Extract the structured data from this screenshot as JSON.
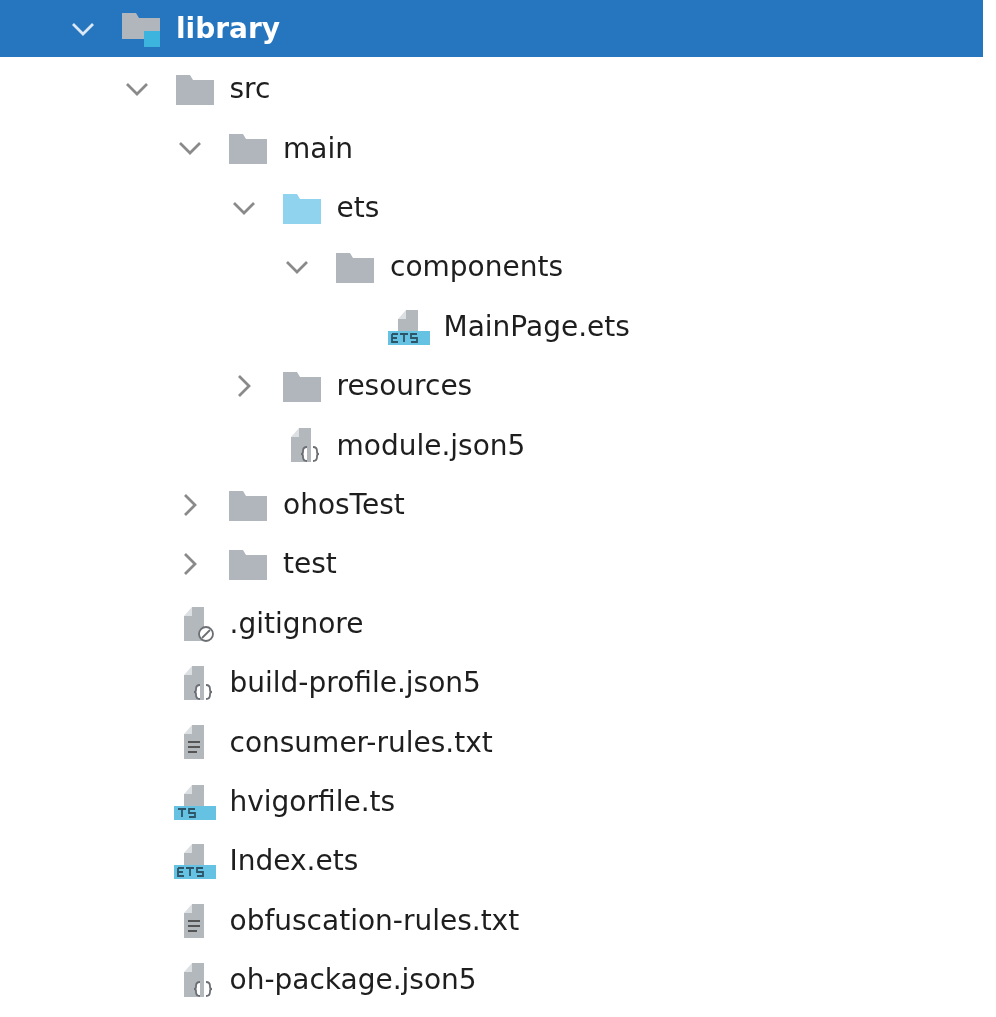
{
  "tree": [
    {
      "name": "library",
      "kind": "module",
      "expanded": true,
      "selected": true,
      "children": [
        {
          "name": "src",
          "kind": "folder",
          "expanded": true,
          "selected": false,
          "children": [
            {
              "name": "main",
              "kind": "folder",
              "expanded": true,
              "selected": false,
              "children": [
                {
                  "name": "ets",
                  "kind": "source-folder",
                  "expanded": true,
                  "selected": false,
                  "children": [
                    {
                      "name": "components",
                      "kind": "folder",
                      "expanded": true,
                      "selected": false,
                      "children": [
                        {
                          "name": "MainPage.ets",
                          "kind": "ets",
                          "selected": false
                        }
                      ]
                    }
                  ]
                },
                {
                  "name": "resources",
                  "kind": "folder",
                  "expanded": false,
                  "selected": false
                },
                {
                  "name": "module.json5",
                  "kind": "json",
                  "selected": false
                }
              ]
            },
            {
              "name": "ohosTest",
              "kind": "folder",
              "expanded": false,
              "selected": false
            },
            {
              "name": "test",
              "kind": "folder",
              "expanded": false,
              "selected": false
            }
          ]
        },
        {
          "name": ".gitignore",
          "kind": "ignore",
          "selected": false
        },
        {
          "name": "build-profile.json5",
          "kind": "json",
          "selected": false
        },
        {
          "name": "consumer-rules.txt",
          "kind": "text",
          "selected": false
        },
        {
          "name": "hvigorfile.ts",
          "kind": "ts",
          "selected": false
        },
        {
          "name": "Index.ets",
          "kind": "ets",
          "selected": false
        },
        {
          "name": "obfuscation-rules.txt",
          "kind": "text",
          "selected": false
        },
        {
          "name": "oh-package.json5",
          "kind": "json",
          "selected": false
        }
      ]
    }
  ]
}
